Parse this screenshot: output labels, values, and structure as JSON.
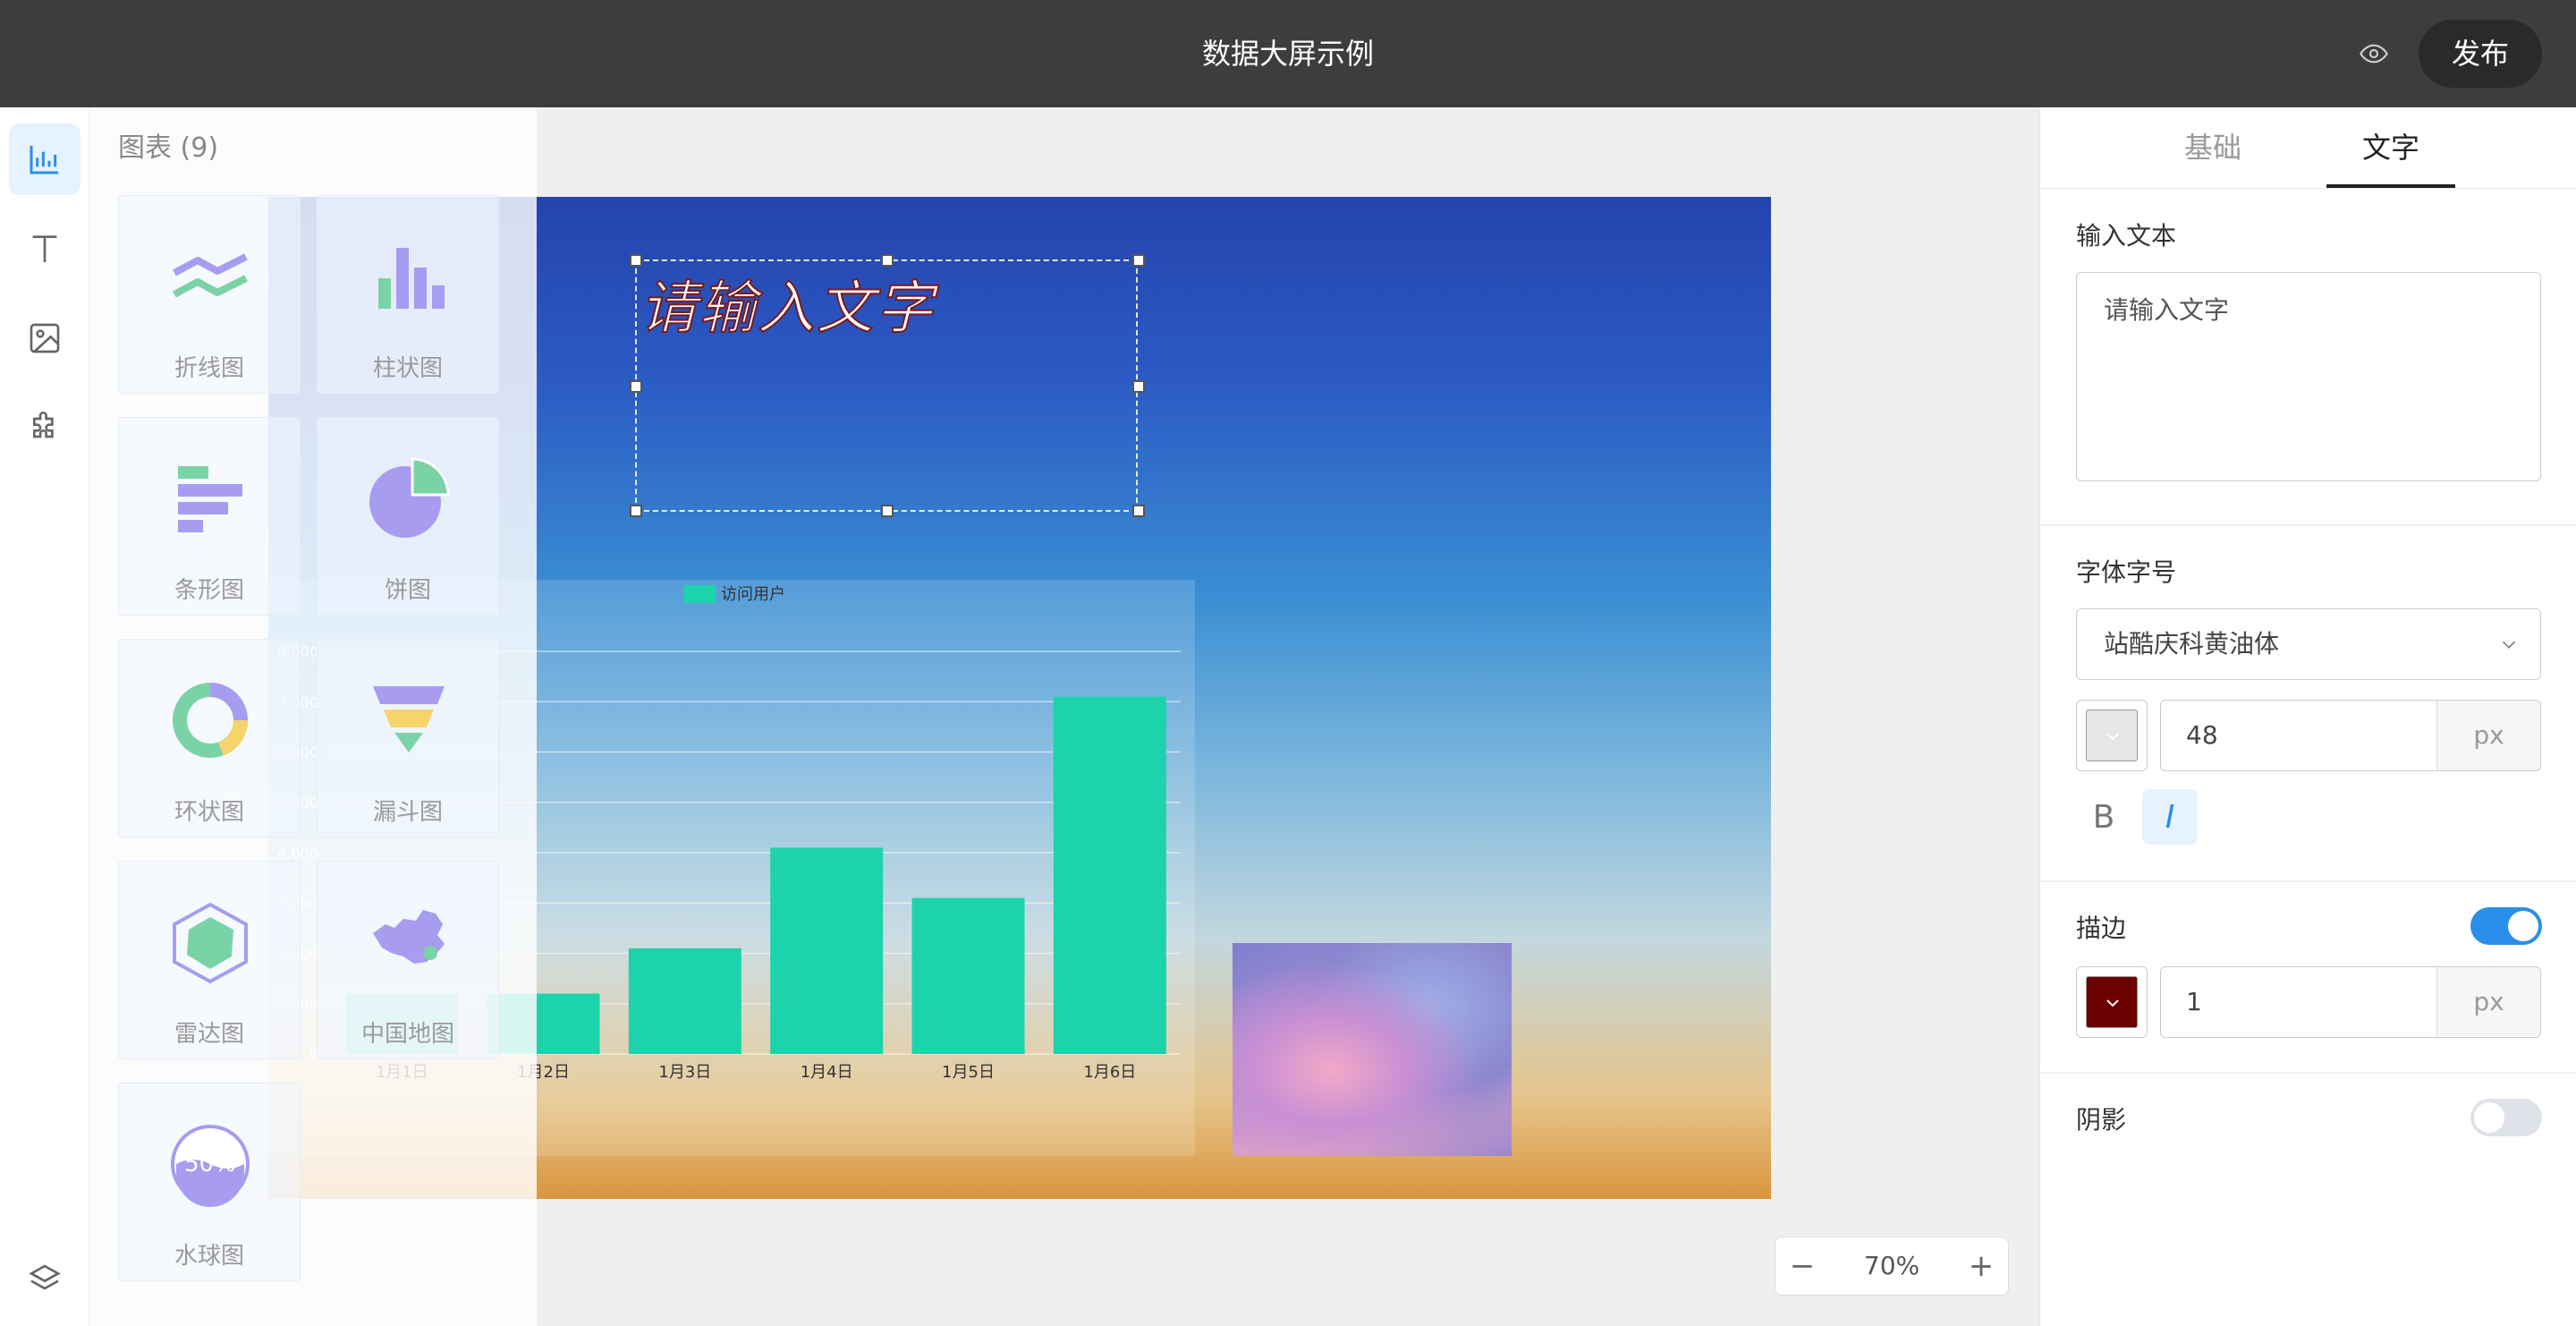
{
  "app": {
    "title": "数据大屏示例",
    "publish_label": "发布"
  },
  "rail": {
    "items": [
      "chart",
      "text",
      "image",
      "plugin"
    ],
    "layers": "layers"
  },
  "panel": {
    "title": "图表 (9)",
    "items": [
      {
        "label": "折线图",
        "icon": "line-chart-icon"
      },
      {
        "label": "柱状图",
        "icon": "bar-chart-icon"
      },
      {
        "label": "条形图",
        "icon": "horizontal-bar-icon"
      },
      {
        "label": "饼图",
        "icon": "pie-chart-icon"
      },
      {
        "label": "环状图",
        "icon": "donut-chart-icon"
      },
      {
        "label": "漏斗图",
        "icon": "funnel-chart-icon"
      },
      {
        "label": "雷达图",
        "icon": "radar-chart-icon"
      },
      {
        "label": "中国地图",
        "icon": "china-map-icon"
      },
      {
        "label": "水球图",
        "icon": "liquid-chart-icon"
      }
    ],
    "liquid_text": "50%"
  },
  "canvas": {
    "text": "请输入文字"
  },
  "chart_data": {
    "type": "bar",
    "categories": [
      "1月1日",
      "1月2日",
      "1月3日",
      "1月4日",
      "1月5日",
      "1月6日"
    ],
    "series": [
      {
        "name": "访问用户",
        "values": [
          1200,
          1200,
          2100,
          4100,
          3100,
          7100
        ],
        "color": "#1dd3ab"
      }
    ],
    "yticks": [
      0,
      1000,
      2000,
      3000,
      4000,
      5000,
      6000,
      7000,
      8000
    ],
    "ylim": [
      0,
      8000
    ]
  },
  "zoom": {
    "minus": "−",
    "value": "70%",
    "plus": "+"
  },
  "right_panel": {
    "tabs": [
      "基础",
      "文字"
    ],
    "active_tab": 1,
    "input_text_label": "输入文本",
    "input_text_value": "请输入文字",
    "font_label": "字体字号",
    "font_family_value": "站酷庆科黄油体",
    "font_color": "#e6e6e6",
    "font_size_value": "48",
    "font_size_unit": "px",
    "bold_label": "B",
    "italic_label": "I",
    "stroke_label": "描边",
    "stroke_on": true,
    "stroke_color": "#6b0000",
    "stroke_width_value": "1",
    "stroke_width_unit": "px",
    "shadow_label": "阴影",
    "shadow_on": false
  }
}
